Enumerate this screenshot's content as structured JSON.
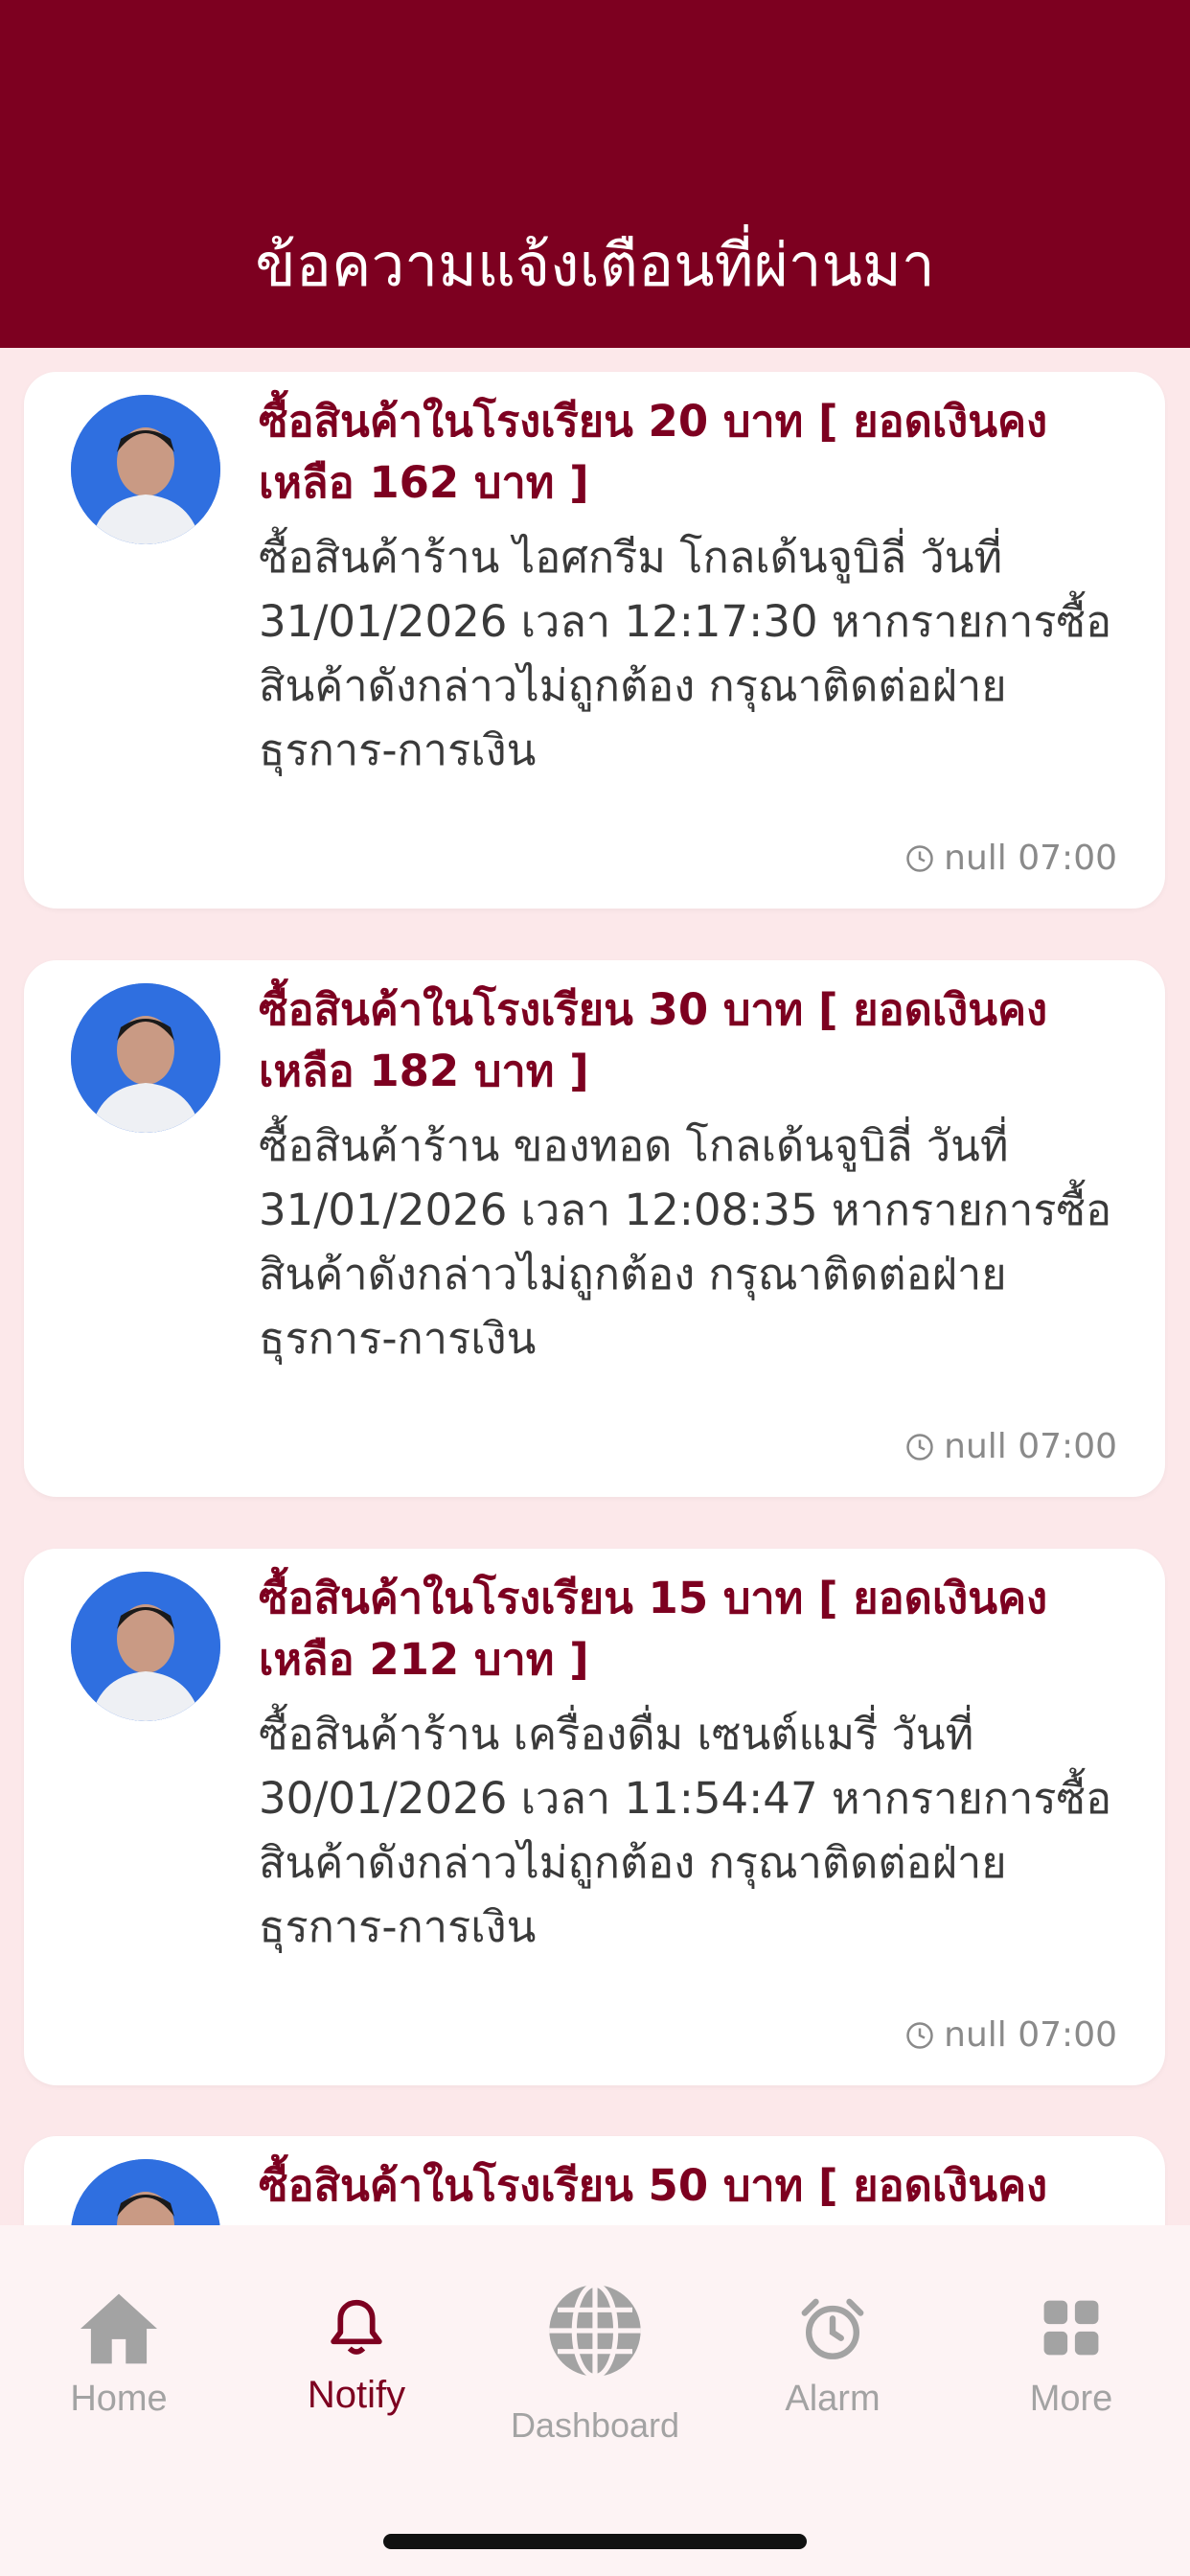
{
  "header": {
    "title": "ข้อความแจ้งเตือนที่ผ่านมา"
  },
  "notifications": [
    {
      "title": "ซื้อสินค้าในโรงเรียน 20 บาท   [ ยอดเงินคงเหลือ 162 บาท  ]",
      "body": "ซื้อสินค้าร้าน  ไอศกรีม โกลเด้นจูบิลี่ วันที่ 31/01/2026 เวลา 12:17:30 หากรายการซื้อสินค้าดังกล่าวไม่ถูกต้อง กรุณาติดต่อฝ่ายธุรการ-การเงิน",
      "time": "null 07:00"
    },
    {
      "title": "ซื้อสินค้าในโรงเรียน 30 บาท   [ ยอดเงินคงเหลือ 182 บาท  ]",
      "body": "ซื้อสินค้าร้าน  ของทอด โกลเด้นจูบิลี่ วันที่ 31/01/2026 เวลา 12:08:35 หากรายการซื้อสินค้าดังกล่าวไม่ถูกต้อง กรุณาติดต่อฝ่ายธุรการ-การเงิน",
      "time": "null 07:00"
    },
    {
      "title": "ซื้อสินค้าในโรงเรียน 15 บาท   [ ยอดเงินคงเหลือ 212 บาท  ]",
      "body": "ซื้อสินค้าร้าน  เครื่องดื่ม เซนต์แมรี่ วันที่ 30/01/2026 เวลา 11:54:47 หากรายการซื้อสินค้าดังกล่าวไม่ถูกต้อง กรุณาติดต่อฝ่ายธุรการ-การเงิน",
      "time": "null 07:00"
    },
    {
      "title": "ซื้อสินค้าในโรงเรียน 50 บาท   [ ยอดเงินคง",
      "body": "",
      "time": ""
    }
  ],
  "tabs": [
    {
      "label": "Home",
      "icon": "home-icon",
      "active": false
    },
    {
      "label": "Notify",
      "icon": "bell-icon",
      "active": true
    },
    {
      "label": "Dashboard",
      "icon": "globe-icon",
      "active": false
    },
    {
      "label": "Alarm",
      "icon": "alarm-clock-icon",
      "active": false
    },
    {
      "label": "More",
      "icon": "grid-icon",
      "active": false
    }
  ],
  "colors": {
    "brand": "#7d0020",
    "background": "#fce8ea",
    "inactive": "#a3a3a3"
  }
}
